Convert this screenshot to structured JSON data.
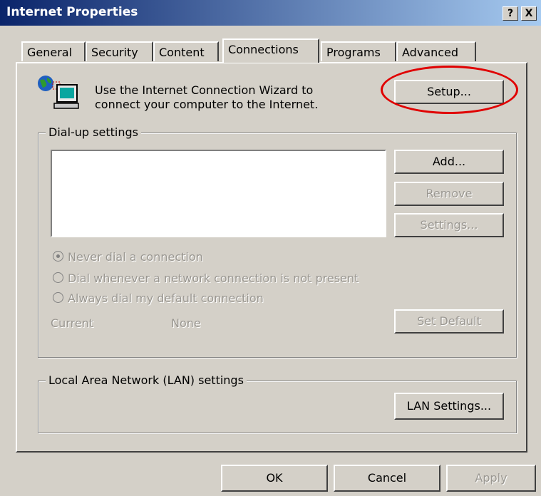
{
  "window": {
    "title": "Internet Properties",
    "help_button": "?",
    "close_button": "X"
  },
  "tabs": [
    {
      "label": "General"
    },
    {
      "label": "Security"
    },
    {
      "label": "Content"
    },
    {
      "label": "Connections",
      "active": true
    },
    {
      "label": "Programs"
    },
    {
      "label": "Advanced"
    }
  ],
  "connection_wizard": {
    "line1": "Use the Internet Connection Wizard to",
    "line2": "connect your computer to the Internet.",
    "setup_label": "Setup...",
    "icon": "network-computer-icon"
  },
  "dialup": {
    "group_label": "Dial-up settings",
    "add_label": "Add...",
    "remove_label": "Remove",
    "settings_label": "Settings...",
    "radio_never": "Never dial a connection",
    "radio_whenever": "Dial whenever a network connection is not present",
    "radio_always": "Always dial my default connection",
    "current_label": "Current",
    "current_value": "None",
    "set_default_label": "Set Default"
  },
  "lan": {
    "group_label": "Local Area Network (LAN) settings",
    "lan_settings_label": "LAN Settings..."
  },
  "footer": {
    "ok_label": "OK",
    "cancel_label": "Cancel",
    "apply_label": "Apply"
  },
  "colors": {
    "dialog_bg": "#d4d0c8",
    "titlebar": "#0a246a",
    "highlight": "#e00000",
    "disabled_text": "#9a9791"
  }
}
